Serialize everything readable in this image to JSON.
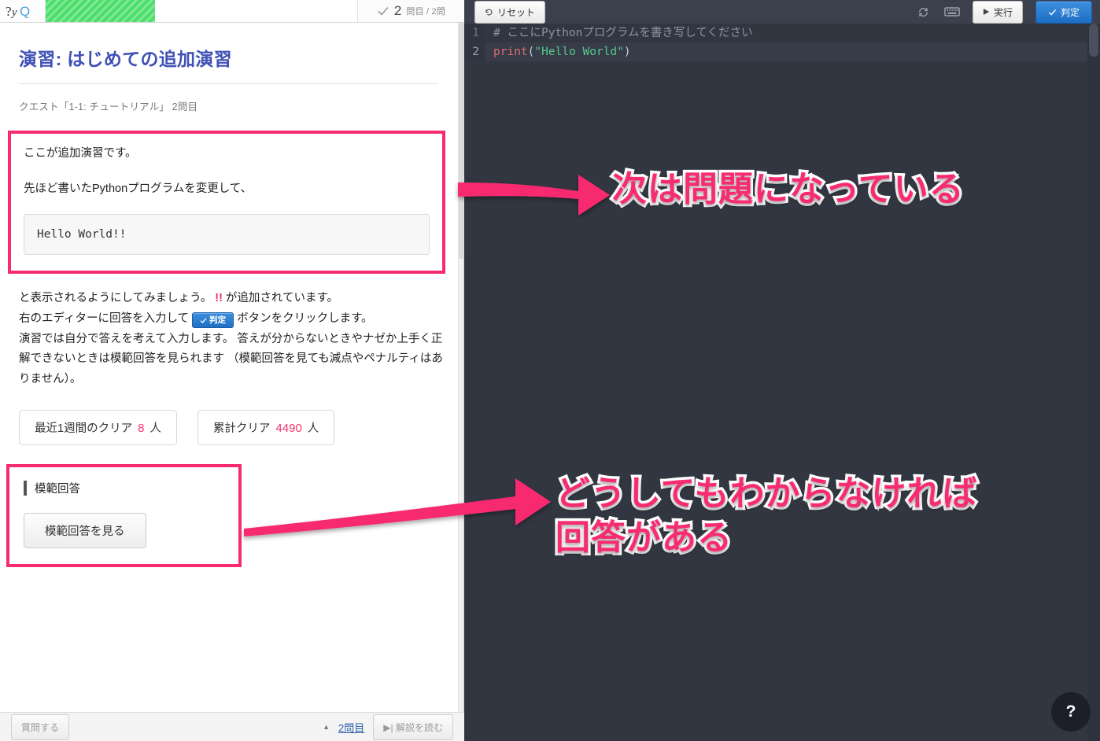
{
  "header": {
    "logo_text": "PyQ",
    "progress_percent": 35,
    "check_icon": "check-icon",
    "question_number": "2",
    "question_label": "問目 / 2問"
  },
  "left": {
    "title": "演習: はじめての追加演習",
    "breadcrumb": "クエスト「1-1: チュートリアル」 2問目",
    "problem": {
      "line1": "ここが追加演習です。",
      "line2": "先ほど書いたPythonプログラムを変更して、",
      "expected_output": "Hello World!!"
    },
    "description": {
      "part1": "と表示されるようにしてみましょう。 ",
      "excl": "!!",
      "part2": " が追加されています。",
      "part3": "右のエディターに回答を入力して ",
      "inline_button": "判定",
      "part4": " ボタンをクリックします。",
      "part5": "演習では自分で答えを考えて入力します。 答えが分からないときやナゼか上手く正解できないときは模範回答を見られます （模範回答を見ても減点やペナルティはありません）。"
    },
    "stats": [
      {
        "label": "最近1週間のクリア",
        "value": "8",
        "unit": "人"
      },
      {
        "label": "累計クリア",
        "value": "4490",
        "unit": "人"
      }
    ],
    "answer_section": {
      "heading": "模範回答",
      "button_label": "模範回答を見る"
    },
    "footer": {
      "ask_label": "質問する",
      "caret": "▲",
      "page_link": "2問目",
      "read_label": "解説を読む",
      "read_icon": "skip-next-icon"
    }
  },
  "editor": {
    "toolbar": {
      "reset_label": "リセット",
      "reset_icon": "undo-icon",
      "sync_icon": "sync-icon",
      "keyboard_icon": "keyboard-icon",
      "run_label": "実行",
      "run_icon": "play-icon",
      "judge_label": "判定",
      "judge_icon": "check-icon"
    },
    "lines": [
      {
        "number": "1",
        "active": false,
        "comment": "# ここにPythonプログラムを書き写してください"
      },
      {
        "number": "2",
        "active": true,
        "fn": "print",
        "open": "(",
        "string": "\"Hello World\"",
        "close": ")"
      }
    ],
    "help_label": "?"
  },
  "annotations": [
    {
      "text": "次は問題になっている"
    },
    {
      "text": "どうしてもわからなければ\n回答がある"
    }
  ],
  "colors": {
    "accent_pink": "#f72b70",
    "title_blue": "#3f51b5",
    "progress_green": "#4ade6a",
    "editor_bg": "#313641",
    "judge_blue": "#1c6ec4"
  }
}
